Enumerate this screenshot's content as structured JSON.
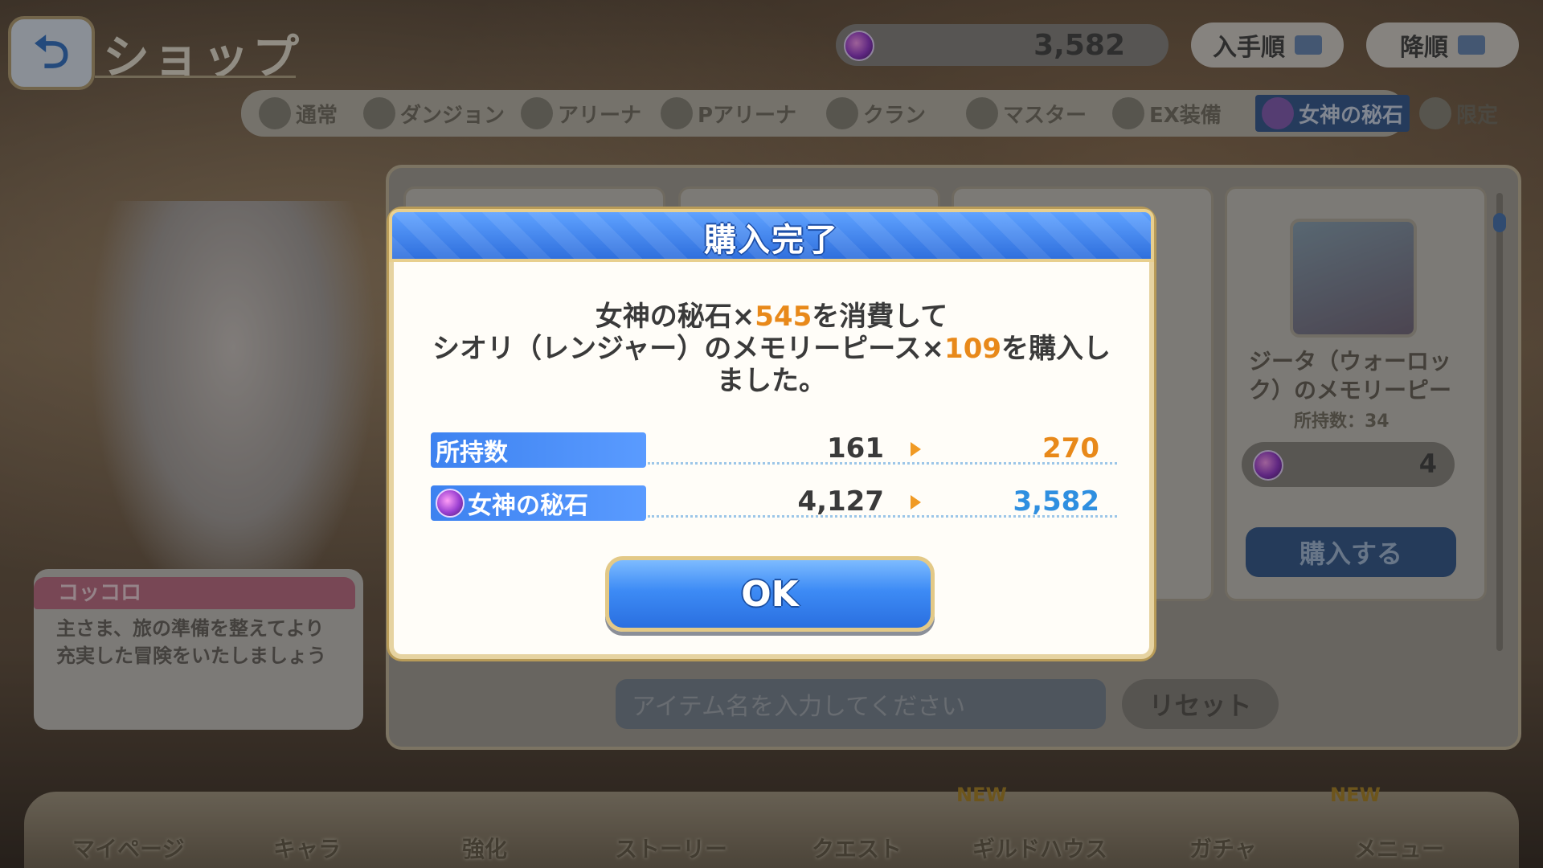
{
  "header": {
    "back_icon": "back-arrow-icon",
    "title": "ショップ",
    "currency": {
      "icon": "goddess-stone-icon",
      "amount": "3,582"
    },
    "sort_order_label": "入手順",
    "sort_label": "降順"
  },
  "tabs": [
    {
      "label": "通常",
      "icon": "normal-coin-icon",
      "active": false
    },
    {
      "label": "ダンジョン",
      "icon": "dungeon-coin-icon",
      "active": false
    },
    {
      "label": "アリーナ",
      "icon": "arena-coin-icon",
      "active": false
    },
    {
      "label": "Pアリーナ",
      "icon": "princess-arena-coin-icon",
      "active": false
    },
    {
      "label": "クラン",
      "icon": "clan-coin-icon",
      "active": false
    },
    {
      "label": "マスター",
      "icon": "master-coin-icon",
      "active": false
    },
    {
      "label": "EX装備",
      "icon": "ex-equip-icon",
      "active": false
    },
    {
      "label": "女神の秘石",
      "icon": "goddess-stone-icon",
      "active": true
    },
    {
      "label": "限定",
      "icon": "limited-coin-icon",
      "active": false
    }
  ],
  "shop_card": {
    "item_name_line1": "ジータ（ウォーロッ",
    "item_name_line2": "ク）のメモリーピー",
    "owned": "所持数：34",
    "price": "4",
    "buy_label": "購入する"
  },
  "search": {
    "placeholder": "アイテム名を入力してください",
    "reset_label": "リセット"
  },
  "character": {
    "name": "コッコロ",
    "line": "主さま、旅の準備を整えてより充実した冒険をいたしましょう"
  },
  "bottom_nav": [
    {
      "label": "マイページ",
      "new": false
    },
    {
      "label": "キャラ",
      "new": false
    },
    {
      "label": "強化",
      "new": false
    },
    {
      "label": "ストーリー",
      "new": false
    },
    {
      "label": "クエスト",
      "new": false
    },
    {
      "label": "ギルドハウス",
      "new": true
    },
    {
      "label": "ガチャ",
      "new": false
    },
    {
      "label": "メニュー",
      "new": true
    }
  ],
  "new_badge": "NEW",
  "dialog": {
    "title": "購入完了",
    "msg1_a": "女神の秘石×",
    "msg1_b": "545",
    "msg1_c": "を消費して",
    "msg2_a": "シオリ（レンジャー）のメモリーピース×",
    "msg2_b": "109",
    "msg2_c": "を購入し",
    "msg3": "ました。",
    "rows": [
      {
        "label": "所持数",
        "icon": "",
        "before": "161",
        "after": "270",
        "after_color": "#e8891a"
      },
      {
        "label": "女神の秘石",
        "icon": "goddess-stone-icon",
        "before": "4,127",
        "after": "3,582",
        "after_color": "#2f8fe0"
      }
    ],
    "ok_label": "OK"
  }
}
